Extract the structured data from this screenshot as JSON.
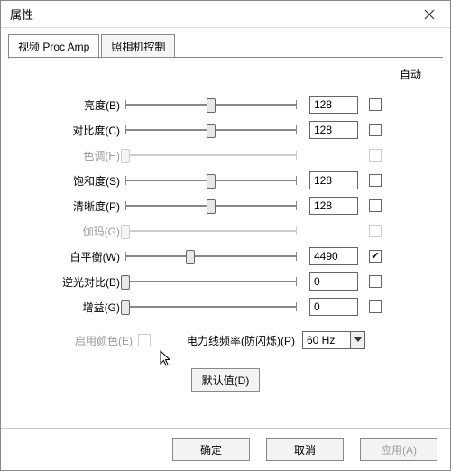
{
  "window": {
    "title": "属性"
  },
  "tabs": {
    "video_proc_amp": "视频 Proc Amp",
    "camera_control": "照相机控制"
  },
  "header": {
    "auto": "自动"
  },
  "rows": {
    "brightness": {
      "label": "亮度(B)",
      "value": "128",
      "thumbPct": 50,
      "disabled": false,
      "autoChecked": false,
      "hasValue": true
    },
    "contrast": {
      "label": "对比度(C)",
      "value": "128",
      "thumbPct": 50,
      "disabled": false,
      "autoChecked": false,
      "hasValue": true
    },
    "hue": {
      "label": "色调(H)",
      "value": "",
      "thumbPct": 0,
      "disabled": true,
      "autoChecked": false,
      "hasValue": false
    },
    "saturation": {
      "label": "饱和度(S)",
      "value": "128",
      "thumbPct": 50,
      "disabled": false,
      "autoChecked": false,
      "hasValue": true
    },
    "sharpness": {
      "label": "清晰度(P)",
      "value": "128",
      "thumbPct": 50,
      "disabled": false,
      "autoChecked": false,
      "hasValue": true
    },
    "gamma": {
      "label": "伽玛(G)",
      "value": "",
      "thumbPct": 0,
      "disabled": true,
      "autoChecked": false,
      "hasValue": false
    },
    "whitebalance": {
      "label": "白平衡(W)",
      "value": "4490",
      "thumbPct": 38,
      "disabled": false,
      "autoChecked": true,
      "hasValue": true
    },
    "backlight": {
      "label": "逆光对比(B)",
      "value": "0",
      "thumbPct": 0,
      "disabled": false,
      "autoChecked": false,
      "hasValue": true
    },
    "gain": {
      "label": "增益(G)",
      "value": "0",
      "thumbPct": 0,
      "disabled": false,
      "autoChecked": false,
      "hasValue": true
    }
  },
  "color_enable": {
    "label": "启用颜色(E)"
  },
  "power_line": {
    "label": "电力线频率(防闪烁)(P)",
    "value": "60 Hz"
  },
  "buttons": {
    "defaults": "默认值(D)",
    "ok": "确定",
    "cancel": "取消",
    "apply": "应用(A)"
  },
  "check_glyph": "✔"
}
